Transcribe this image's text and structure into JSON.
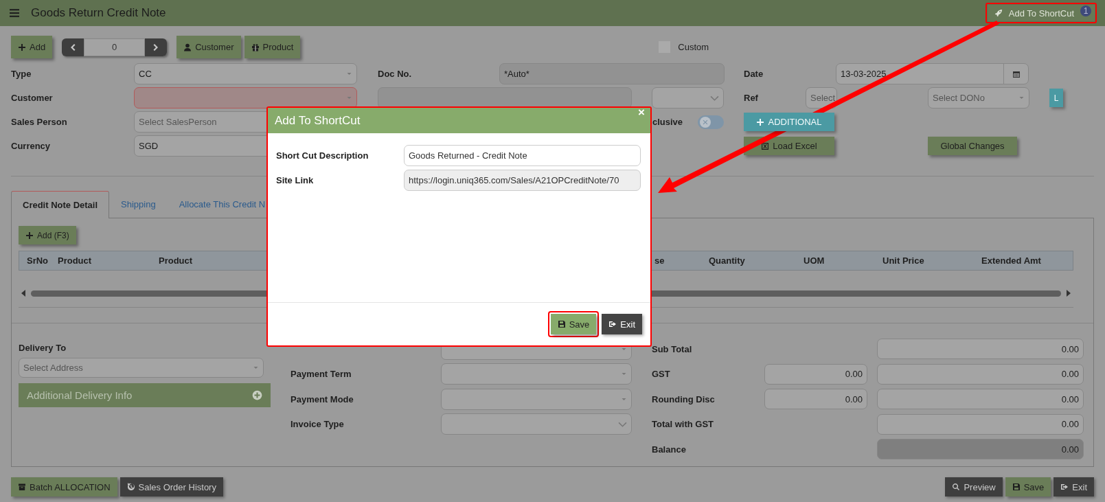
{
  "header": {
    "title": "Goods Return Credit Note",
    "shortcut": {
      "label": "Add To ShortCut",
      "badge": "1",
      "highlighted": true
    }
  },
  "toolbar": {
    "add": "Add",
    "record": "0",
    "customer": "Customer",
    "product": "Product",
    "custom": {
      "label": "Custom",
      "checked": false
    }
  },
  "form": {
    "type": {
      "label": "Type",
      "value": "CC"
    },
    "customer": {
      "label": "Customer",
      "invalid": true
    },
    "sales_person": {
      "label": "Sales Person",
      "placeholder": "Select SalesPerson"
    },
    "currency": {
      "label": "Currency",
      "value": "SGD"
    },
    "doc_no": {
      "label": "Doc No.",
      "value": "*Auto*"
    },
    "inclusive": {
      "label": "clusive",
      "on": false
    },
    "date": {
      "label": "Date",
      "value": "13-03-2025"
    },
    "ref": {
      "label": "Ref",
      "placeholder": "Select",
      "do_placeholder": "Select DONo",
      "button": "L"
    },
    "additional": "ADDITIONAL",
    "load_excel": "Load Excel",
    "global_changes": "Global Changes"
  },
  "tabs": [
    {
      "label": "Credit Note Detail",
      "selected": true
    },
    {
      "label": "Shipping",
      "selected": false
    },
    {
      "label": "Allocate This Credit N",
      "selected": false
    }
  ],
  "detail": {
    "add": "Add (F3)",
    "columns": [
      "SrNo",
      "Product",
      "Product",
      "se",
      "Quantity",
      "UOM",
      "Unit Price",
      "Extended Amt"
    ]
  },
  "delivery": {
    "label": "Delivery To",
    "placeholder": "Select Address",
    "info": "Additional Delivery Info"
  },
  "payment": [
    {
      "kind": "select"
    },
    {
      "label": "Payment Term",
      "kind": "select"
    },
    {
      "label": "Payment Mode",
      "kind": "select"
    },
    {
      "label": "Invoice Type",
      "kind": "dropdown"
    }
  ],
  "totals": [
    {
      "label": "Sub Total",
      "values": [
        "0.00"
      ],
      "disabled": false
    },
    {
      "label": "GST",
      "values": [
        "0.00",
        "0.00"
      ],
      "disabled": false
    },
    {
      "label": "Rounding Disc",
      "values": [
        "0.00",
        "0.00"
      ],
      "disabled": false
    },
    {
      "label": "Total with GST",
      "values": [
        "0.00"
      ],
      "disabled": false
    },
    {
      "label": "Balance",
      "values": [
        "0.00"
      ],
      "disabled": true
    }
  ],
  "footer": {
    "left": [
      {
        "label": "Batch ALLOCATION",
        "kind": "batch"
      },
      {
        "label": "Sales Order History",
        "kind": "history"
      }
    ],
    "right": [
      {
        "label": "Preview",
        "kind": "preview"
      },
      {
        "label": "Save",
        "kind": "save"
      },
      {
        "label": "Exit",
        "kind": "exit"
      }
    ]
  },
  "modal": {
    "title": "Add To ShortCut",
    "close": "×",
    "fields": [
      {
        "label": "Short Cut Description",
        "value": "Goods Returned - Credit Note",
        "disabled": false
      },
      {
        "label": "Site Link",
        "value": "https://login.uniq365.com/Sales/A21OPCreditNote/70",
        "disabled": true
      }
    ],
    "buttons": [
      {
        "label": "Save",
        "kind": "save",
        "highlighted": true
      },
      {
        "label": "Exit",
        "kind": "exit",
        "highlighted": false
      }
    ]
  }
}
